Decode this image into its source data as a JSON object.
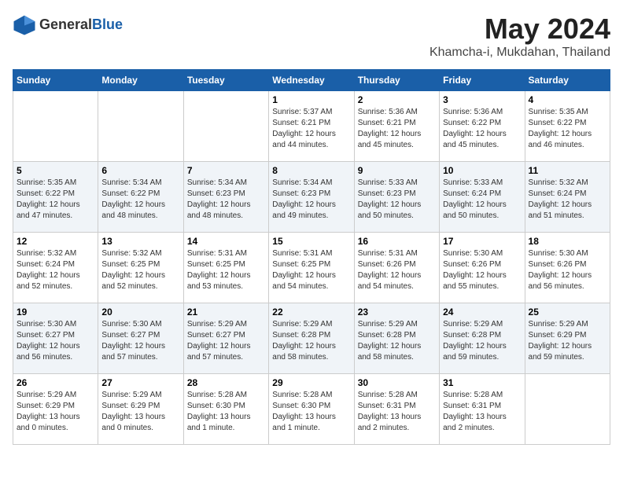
{
  "header": {
    "logo": {
      "text_general": "General",
      "text_blue": "Blue"
    },
    "month": "May 2024",
    "location": "Khamcha-i, Mukdahan, Thailand"
  },
  "weekdays": [
    "Sunday",
    "Monday",
    "Tuesday",
    "Wednesday",
    "Thursday",
    "Friday",
    "Saturday"
  ],
  "weeks": [
    [
      {
        "day": "",
        "sunrise": "",
        "sunset": "",
        "daylight": ""
      },
      {
        "day": "",
        "sunrise": "",
        "sunset": "",
        "daylight": ""
      },
      {
        "day": "",
        "sunrise": "",
        "sunset": "",
        "daylight": ""
      },
      {
        "day": "1",
        "sunrise": "Sunrise: 5:37 AM",
        "sunset": "Sunset: 6:21 PM",
        "daylight": "Daylight: 12 hours and 44 minutes."
      },
      {
        "day": "2",
        "sunrise": "Sunrise: 5:36 AM",
        "sunset": "Sunset: 6:21 PM",
        "daylight": "Daylight: 12 hours and 45 minutes."
      },
      {
        "day": "3",
        "sunrise": "Sunrise: 5:36 AM",
        "sunset": "Sunset: 6:22 PM",
        "daylight": "Daylight: 12 hours and 45 minutes."
      },
      {
        "day": "4",
        "sunrise": "Sunrise: 5:35 AM",
        "sunset": "Sunset: 6:22 PM",
        "daylight": "Daylight: 12 hours and 46 minutes."
      }
    ],
    [
      {
        "day": "5",
        "sunrise": "Sunrise: 5:35 AM",
        "sunset": "Sunset: 6:22 PM",
        "daylight": "Daylight: 12 hours and 47 minutes."
      },
      {
        "day": "6",
        "sunrise": "Sunrise: 5:34 AM",
        "sunset": "Sunset: 6:22 PM",
        "daylight": "Daylight: 12 hours and 48 minutes."
      },
      {
        "day": "7",
        "sunrise": "Sunrise: 5:34 AM",
        "sunset": "Sunset: 6:23 PM",
        "daylight": "Daylight: 12 hours and 48 minutes."
      },
      {
        "day": "8",
        "sunrise": "Sunrise: 5:34 AM",
        "sunset": "Sunset: 6:23 PM",
        "daylight": "Daylight: 12 hours and 49 minutes."
      },
      {
        "day": "9",
        "sunrise": "Sunrise: 5:33 AM",
        "sunset": "Sunset: 6:23 PM",
        "daylight": "Daylight: 12 hours and 50 minutes."
      },
      {
        "day": "10",
        "sunrise": "Sunrise: 5:33 AM",
        "sunset": "Sunset: 6:24 PM",
        "daylight": "Daylight: 12 hours and 50 minutes."
      },
      {
        "day": "11",
        "sunrise": "Sunrise: 5:32 AM",
        "sunset": "Sunset: 6:24 PM",
        "daylight": "Daylight: 12 hours and 51 minutes."
      }
    ],
    [
      {
        "day": "12",
        "sunrise": "Sunrise: 5:32 AM",
        "sunset": "Sunset: 6:24 PM",
        "daylight": "Daylight: 12 hours and 52 minutes."
      },
      {
        "day": "13",
        "sunrise": "Sunrise: 5:32 AM",
        "sunset": "Sunset: 6:25 PM",
        "daylight": "Daylight: 12 hours and 52 minutes."
      },
      {
        "day": "14",
        "sunrise": "Sunrise: 5:31 AM",
        "sunset": "Sunset: 6:25 PM",
        "daylight": "Daylight: 12 hours and 53 minutes."
      },
      {
        "day": "15",
        "sunrise": "Sunrise: 5:31 AM",
        "sunset": "Sunset: 6:25 PM",
        "daylight": "Daylight: 12 hours and 54 minutes."
      },
      {
        "day": "16",
        "sunrise": "Sunrise: 5:31 AM",
        "sunset": "Sunset: 6:26 PM",
        "daylight": "Daylight: 12 hours and 54 minutes."
      },
      {
        "day": "17",
        "sunrise": "Sunrise: 5:30 AM",
        "sunset": "Sunset: 6:26 PM",
        "daylight": "Daylight: 12 hours and 55 minutes."
      },
      {
        "day": "18",
        "sunrise": "Sunrise: 5:30 AM",
        "sunset": "Sunset: 6:26 PM",
        "daylight": "Daylight: 12 hours and 56 minutes."
      }
    ],
    [
      {
        "day": "19",
        "sunrise": "Sunrise: 5:30 AM",
        "sunset": "Sunset: 6:27 PM",
        "daylight": "Daylight: 12 hours and 56 minutes."
      },
      {
        "day": "20",
        "sunrise": "Sunrise: 5:30 AM",
        "sunset": "Sunset: 6:27 PM",
        "daylight": "Daylight: 12 hours and 57 minutes."
      },
      {
        "day": "21",
        "sunrise": "Sunrise: 5:29 AM",
        "sunset": "Sunset: 6:27 PM",
        "daylight": "Daylight: 12 hours and 57 minutes."
      },
      {
        "day": "22",
        "sunrise": "Sunrise: 5:29 AM",
        "sunset": "Sunset: 6:28 PM",
        "daylight": "Daylight: 12 hours and 58 minutes."
      },
      {
        "day": "23",
        "sunrise": "Sunrise: 5:29 AM",
        "sunset": "Sunset: 6:28 PM",
        "daylight": "Daylight: 12 hours and 58 minutes."
      },
      {
        "day": "24",
        "sunrise": "Sunrise: 5:29 AM",
        "sunset": "Sunset: 6:28 PM",
        "daylight": "Daylight: 12 hours and 59 minutes."
      },
      {
        "day": "25",
        "sunrise": "Sunrise: 5:29 AM",
        "sunset": "Sunset: 6:29 PM",
        "daylight": "Daylight: 12 hours and 59 minutes."
      }
    ],
    [
      {
        "day": "26",
        "sunrise": "Sunrise: 5:29 AM",
        "sunset": "Sunset: 6:29 PM",
        "daylight": "Daylight: 13 hours and 0 minutes."
      },
      {
        "day": "27",
        "sunrise": "Sunrise: 5:29 AM",
        "sunset": "Sunset: 6:29 PM",
        "daylight": "Daylight: 13 hours and 0 minutes."
      },
      {
        "day": "28",
        "sunrise": "Sunrise: 5:28 AM",
        "sunset": "Sunset: 6:30 PM",
        "daylight": "Daylight: 13 hours and 1 minute."
      },
      {
        "day": "29",
        "sunrise": "Sunrise: 5:28 AM",
        "sunset": "Sunset: 6:30 PM",
        "daylight": "Daylight: 13 hours and 1 minute."
      },
      {
        "day": "30",
        "sunrise": "Sunrise: 5:28 AM",
        "sunset": "Sunset: 6:31 PM",
        "daylight": "Daylight: 13 hours and 2 minutes."
      },
      {
        "day": "31",
        "sunrise": "Sunrise: 5:28 AM",
        "sunset": "Sunset: 6:31 PM",
        "daylight": "Daylight: 13 hours and 2 minutes."
      },
      {
        "day": "",
        "sunrise": "",
        "sunset": "",
        "daylight": ""
      }
    ]
  ]
}
